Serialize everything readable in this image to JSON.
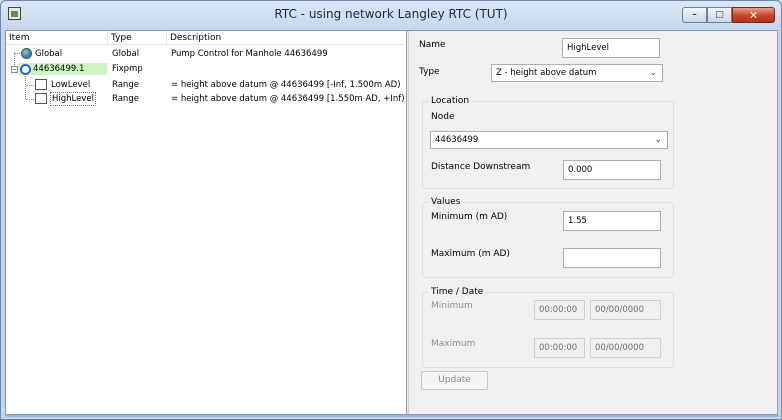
{
  "window": {
    "title": "RTC -  using network Langley RTC (TUT)"
  },
  "tree": {
    "columns": [
      "Item",
      "Type",
      "Description"
    ],
    "rows": [
      {
        "item": "Global",
        "type": "Global",
        "description": "Pump Control for Manhole 44636499",
        "icon": "globe-icon",
        "selected": false
      },
      {
        "item": "44636499.1",
        "type": "Fixpmp",
        "description": "",
        "icon": "pump-icon",
        "selected": true
      },
      {
        "item": "LowLevel",
        "type": "Range",
        "description": "= height above datum @ 44636499 [-Inf, 1.500m AD)",
        "icon": "range-icon",
        "selected": false
      },
      {
        "item": "HighLevel",
        "type": "Range",
        "description": "= height above datum @ 44636499 [1.550m AD, +Inf)",
        "icon": "range-icon",
        "selected": false
      }
    ]
  },
  "props": {
    "name_label": "Name",
    "name_value": "HighLevel",
    "type_label": "Type",
    "type_value": "Z - height above datum",
    "location_group": "Location",
    "node_label": "Node",
    "node_value": "44636499",
    "distance_label": "Distance Downstream",
    "distance_value": "0.000",
    "values_group": "Values",
    "minimum_label": "Minimum (m AD)",
    "minimum_value": "1.55",
    "maximum_label": "Maximum (m AD)",
    "maximum_value": "",
    "time_group": "Time / Date",
    "time_min_label": "Minimum",
    "time_min_time": "00:00:00",
    "time_min_date": "00/00/0000",
    "time_max_label": "Maximum",
    "time_max_time": "00:00:00",
    "time_max_date": "00/00/0000",
    "update_label": "Update"
  },
  "colors": {
    "selection": "#cdf5c2",
    "close_button": "#c7432a"
  }
}
